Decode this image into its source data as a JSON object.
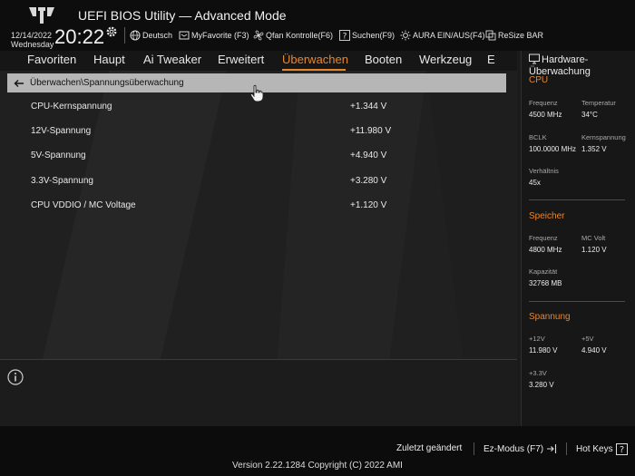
{
  "header": {
    "title": "UEFI BIOS Utility — Advanced Mode",
    "date": "12/14/2022",
    "weekday": "Wednesday",
    "time": "20:22",
    "items": [
      {
        "label": "Deutsch",
        "icon": "globe-icon"
      },
      {
        "label": "MyFavorite (F3)",
        "icon": "favorite-icon"
      },
      {
        "label": "Qfan Kontrolle(F6)",
        "icon": "fan-icon"
      },
      {
        "label": "Suchen(F9)",
        "icon": "search-icon"
      },
      {
        "label": "AURA EIN/AUS(F4)",
        "icon": "aura-icon"
      },
      {
        "label": "ReSize BAR",
        "icon": "resize-bar-icon"
      }
    ]
  },
  "nav": {
    "tabs": [
      "Favoriten",
      "Haupt",
      "Ai Tweaker",
      "Erweitert",
      "Überwachen",
      "Booten",
      "Werkzeug",
      "E"
    ],
    "active": "Überwachen"
  },
  "main": {
    "breadcrumb": "Überwachen\\Spannungsüberwachung",
    "rows": [
      {
        "label": "CPU-Kernspannung",
        "value": "+1.344 V"
      },
      {
        "label": "12V-Spannung",
        "value": "+11.980 V"
      },
      {
        "label": "5V-Spannung",
        "value": "+4.940 V"
      },
      {
        "label": "3.3V-Spannung",
        "value": "+3.280 V"
      },
      {
        "label": "CPU VDDIO / MC Voltage",
        "value": "+1.120 V"
      }
    ]
  },
  "hw_monitor": {
    "title": "Hardware-Überwachung",
    "cpu": {
      "section": "CPU",
      "freq_label": "Frequenz",
      "freq_value": "4500 MHz",
      "temp_label": "Temperatur",
      "temp_value": "34°C",
      "bclk_label": "BCLK",
      "bclk_value": "100.0000 MHz",
      "core_label": "Kernspannung",
      "core_value": "1.352 V",
      "ratio_label": "Verhältnis",
      "ratio_value": "45x"
    },
    "memory": {
      "section": "Speicher",
      "freq_label": "Frequenz",
      "freq_value": "4800 MHz",
      "mcvolt_label": "MC Volt",
      "mcvolt_value": "1.120 V",
      "cap_label": "Kapazität",
      "cap_value": "32768 MB"
    },
    "voltage": {
      "section": "Spannung",
      "v12_label": "+12V",
      "v12_value": "11.980 V",
      "v5_label": "+5V",
      "v5_value": "4.940 V",
      "v33_label": "+3.3V",
      "v33_value": "3.280 V"
    }
  },
  "footer": {
    "last_changed": "Zuletzt geändert",
    "ez_mode": "Ez-Modus (F7)",
    "hot_keys": "Hot Keys",
    "version": "Version 2.22.1284 Copyright (C) 2022 AMI"
  },
  "colors": {
    "accent": "#e8862c",
    "background": "#202020",
    "header": "#0d0d0d"
  }
}
